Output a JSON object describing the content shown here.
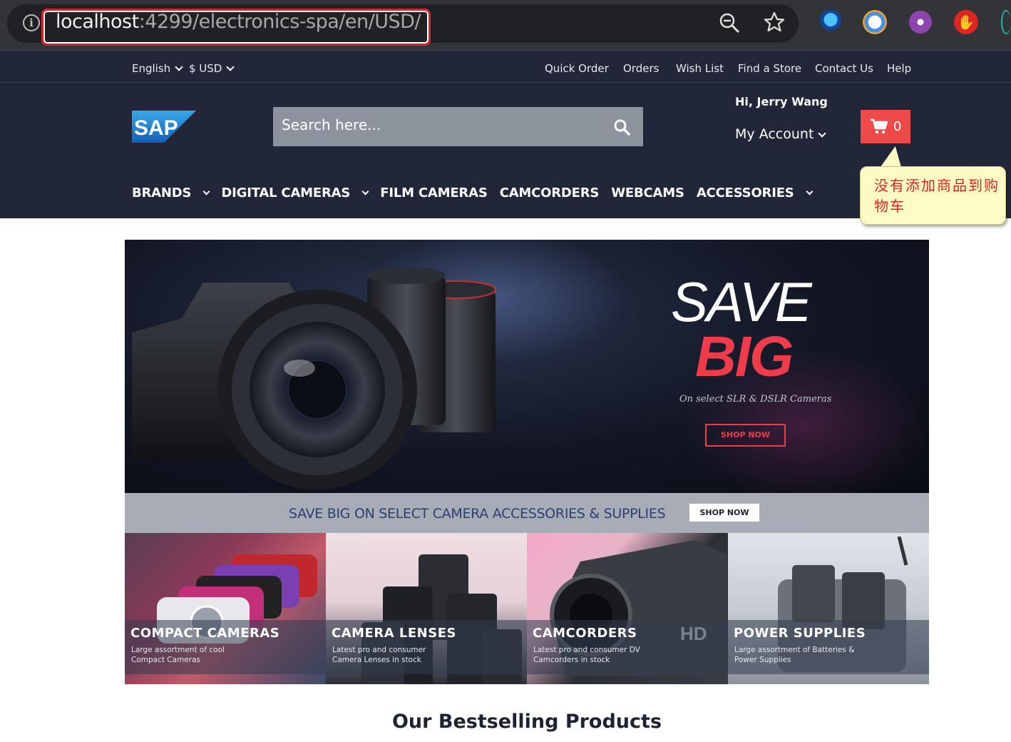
{
  "browser": {
    "url_host": "localhost",
    "url_rest": ":4299/electronics-spa/en/USD/"
  },
  "topbar": {
    "language": "English",
    "currency": "$ USD",
    "links": [
      "Quick Order",
      "Orders",
      "Wish List",
      "Find a Store",
      "Contact Us",
      "Help"
    ]
  },
  "header": {
    "logo_text": "SAP",
    "search_placeholder": "Search here...",
    "greeting": "Hi, Jerry Wang",
    "account_label": "My Account",
    "cart_count": "0"
  },
  "nav": {
    "items": [
      "BRANDS",
      "DIGITAL CAMERAS",
      "FILM CAMERAS",
      "CAMCORDERS",
      "WEBCAMS",
      "ACCESSORIES"
    ]
  },
  "callout": {
    "text": "没有添加商品到购物车"
  },
  "hero": {
    "line1": "SAVE",
    "line2": "BIG",
    "subtitle": "On select SLR & DSLR Cameras",
    "cta": "SHOP NOW"
  },
  "strip": {
    "text": "SAVE BIG ON SELECT CAMERA ACCESSORIES & SUPPLIES",
    "cta": "SHOP NOW"
  },
  "tiles": [
    {
      "title": "COMPACT CAMERAS",
      "desc": "Large assortment of cool Compact Cameras"
    },
    {
      "title": "CAMERA LENSES",
      "desc": "Latest pro and consumer Camera Lenses in stock"
    },
    {
      "title": "CAMCORDERS",
      "desc": "Latest pro and consumer DV Camcorders in stock"
    },
    {
      "title": "POWER SUPPLIES",
      "desc": "Large assortment of Batteries & Power Supplies"
    }
  ],
  "section": {
    "title": "Our Bestselling Products"
  },
  "colors": {
    "header_bg": "#212738",
    "cart_bg": "#ef4a4a",
    "accent_red": "#ef3b4a",
    "callout_bg": "#fefcc4"
  }
}
